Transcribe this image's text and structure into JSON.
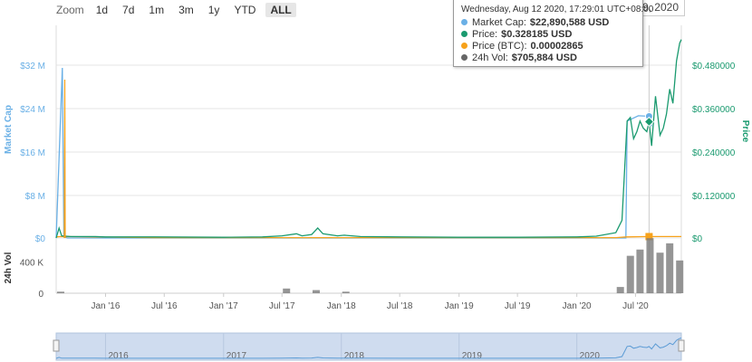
{
  "zoom": {
    "label": "Zoom",
    "buttons": [
      "1d",
      "7d",
      "1m",
      "3m",
      "1y",
      "YTD",
      "ALL"
    ],
    "active": "ALL"
  },
  "date_input": {
    "value": "9, 2020"
  },
  "tooltip": {
    "header": "Wednesday, Aug 12 2020, 17:29:01 UTC+08:00",
    "rows": [
      {
        "label": "Market Cap:",
        "value": "$22,890,588 USD",
        "color": "#6ab0e6"
      },
      {
        "label": "Price:",
        "value": "$0.328185 USD",
        "color": "#1a9a6f"
      },
      {
        "label": "Price (BTC):",
        "value": "0.00002865",
        "color": "#f7a21b"
      },
      {
        "label": "24h Vol:",
        "value": "$705,884 USD",
        "color": "#666666"
      }
    ]
  },
  "colors": {
    "market_cap": "#6ab0e6",
    "price": "#1a9a6f",
    "price_btc": "#f7a21b",
    "volume": "#7a7a7a",
    "grid": "#e6e6e6",
    "navigator_fill": "#cfdcef"
  },
  "chart_data": [
    {
      "type": "line",
      "left_axis": {
        "label": "Market Cap",
        "ticks": [
          "$0",
          "$8 M",
          "$16 M",
          "$24 M",
          "$32 M"
        ],
        "ylim": [
          0,
          40000000
        ]
      },
      "right_axis": {
        "label": "Price",
        "ticks": [
          "$0",
          "$0.120000",
          "$0.240000",
          "$0.360000",
          "$0.480000"
        ],
        "ylim": [
          0,
          0.6
        ]
      },
      "x_ticks": [
        "Jan '16",
        "Jul '16",
        "Jan '17",
        "Jul '17",
        "Jan '18",
        "Jul '18",
        "Jan '19",
        "Jul '19",
        "Jan '20",
        "Jul '20"
      ],
      "xlim": [
        "2015-08-01",
        "2020-11-20"
      ],
      "series": [
        {
          "name": "Price",
          "axis": "right",
          "points": [
            [
              "2015-08-01",
              0.0
            ],
            [
              "2015-08-10",
              0.028
            ],
            [
              "2015-08-18",
              0.006
            ],
            [
              "2015-09-15",
              0.004
            ],
            [
              "2015-12-01",
              0.004
            ],
            [
              "2016-01-01",
              0.003
            ],
            [
              "2016-06-01",
              0.003
            ],
            [
              "2017-01-01",
              0.002
            ],
            [
              "2017-05-01",
              0.003
            ],
            [
              "2017-07-01",
              0.006
            ],
            [
              "2017-08-15",
              0.012
            ],
            [
              "2017-09-01",
              0.006
            ],
            [
              "2017-10-01",
              0.01
            ],
            [
              "2017-10-20",
              0.028
            ],
            [
              "2017-11-05",
              0.012
            ],
            [
              "2017-12-20",
              0.006
            ],
            [
              "2018-01-10",
              0.008
            ],
            [
              "2018-03-01",
              0.004
            ],
            [
              "2018-07-01",
              0.003
            ],
            [
              "2019-01-01",
              0.002
            ],
            [
              "2019-07-01",
              0.002
            ],
            [
              "2020-01-01",
              0.003
            ],
            [
              "2020-03-01",
              0.005
            ],
            [
              "2020-05-01",
              0.015
            ],
            [
              "2020-05-20",
              0.05
            ],
            [
              "2020-06-05",
              0.33
            ],
            [
              "2020-06-15",
              0.34
            ],
            [
              "2020-06-25",
              0.28
            ],
            [
              "2020-07-05",
              0.3
            ],
            [
              "2020-07-15",
              0.33
            ],
            [
              "2020-07-25",
              0.31
            ],
            [
              "2020-08-05",
              0.3
            ],
            [
              "2020-08-12",
              0.328
            ],
            [
              "2020-08-20",
              0.26
            ],
            [
              "2020-09-01",
              0.4
            ],
            [
              "2020-09-15",
              0.29
            ],
            [
              "2020-09-25",
              0.31
            ],
            [
              "2020-10-05",
              0.35
            ],
            [
              "2020-10-15",
              0.42
            ],
            [
              "2020-10-25",
              0.38
            ],
            [
              "2020-11-05",
              0.5
            ],
            [
              "2020-11-15",
              0.55
            ],
            [
              "2020-11-20",
              0.56
            ]
          ]
        },
        {
          "name": "Market Cap",
          "axis": "left",
          "points": [
            [
              "2015-08-01",
              0
            ],
            [
              "2015-08-20",
              32000000
            ],
            [
              "2015-08-25",
              200000
            ],
            [
              "2015-09-05",
              0
            ],
            [
              "2020-06-01",
              0
            ],
            [
              "2020-06-05",
              22000000
            ],
            [
              "2020-07-10",
              23000000
            ],
            [
              "2020-08-12",
              22890588
            ],
            [
              "2020-08-20",
              21000000
            ]
          ]
        },
        {
          "name": "Price (BTC)",
          "axis": "right",
          "points": [
            [
              "2015-08-01",
              0.003
            ],
            [
              "2015-08-15",
              0.004
            ],
            [
              "2016-06-01",
              0.001
            ],
            [
              "2017-06-01",
              0.001
            ],
            [
              "2018-06-01",
              0.001
            ],
            [
              "2019-06-01",
              0.001
            ],
            [
              "2020-05-01",
              0.001
            ],
            [
              "2020-06-01",
              0.003
            ],
            [
              "2020-08-12",
              0.004
            ],
            [
              "2020-11-20",
              0.004
            ]
          ]
        }
      ]
    },
    {
      "type": "bar",
      "axis_label": "24h Vol",
      "ticks": [
        "0",
        "400 K"
      ],
      "ylim": [
        0,
        650000
      ],
      "x": [
        "2015-08",
        "2017-07",
        "2017-10",
        "2018-01",
        "2020-05",
        "2020-06",
        "2020-07",
        "2020-08",
        "2020-09",
        "2020-10",
        "2020-11"
      ],
      "values": [
        20000,
        60000,
        40000,
        20000,
        80000,
        480000,
        560000,
        705884,
        520000,
        640000,
        420000
      ]
    }
  ],
  "navigator": {
    "years": [
      "2016",
      "2017",
      "2018",
      "2019",
      "2020"
    ]
  }
}
